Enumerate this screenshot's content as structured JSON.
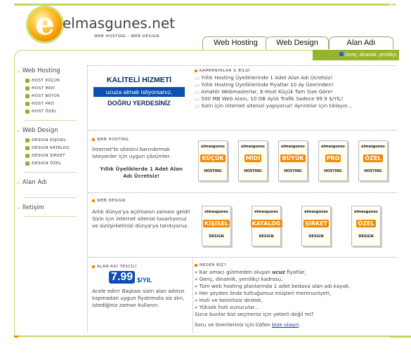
{
  "site": {
    "logo_glyph": "e",
    "name": "elmasgunes.net",
    "tagline": "WEB HOSTING - WEB DESIGN",
    "slogan": "Genç, dinamik, yenilikçi",
    "tabs": [
      {
        "label": "Web Hosting"
      },
      {
        "label": "Web Design"
      },
      {
        "label": "Alan Adı"
      }
    ],
    "accent_color": "#96b52e",
    "highlight_color": "#f08a00"
  },
  "sidebar": {
    "web_hosting": "Web Hosting",
    "hosting_items": [
      "-HOST KÜÇÜK",
      "-HOST MİDİ",
      "-HOST BÜYÜK",
      "-HOST PRO",
      "-HOST ÖZEL"
    ],
    "web_design": "Web Design",
    "design_items": [
      "-DESIGN KİŞİSEL",
      "-DESIGN KATALOG",
      "-DESIGN ŞİRKET",
      "-DESIGN ÖZEL"
    ],
    "alan_adi": "Alan Adı",
    "iletisim": "İletişim"
  },
  "promo": {
    "line1": "KALİTELİ HİZMETİ",
    "line2": "ucuza almak istiyorsanız,",
    "line3": "DOĞRU YERDESİNİZ"
  },
  "campaigns": {
    "heading": "KAMPANYALAR & BİLGİ",
    "items": [
      ":.: Yıllık Hosting Üyeliklerinde 1 Adet Alan Adı Ücretsiz!",
      ":.: Yıllık Hosting Üyeliklerinde Fiyatlar 10 Ay Üzerinden!",
      ":.: Amatör Webmasterlar, E-Host Küçük Tam Size Göre!",
      ":.: 500 MB Web Alanı, 10 GB Aylık Trafik Sadece 99.9 $/YIL!",
      ":.: Sizin için internet sitenizi yapıyoruz! Ayrıntılar için tıklayın..."
    ]
  },
  "hosting": {
    "heading": "WEB HOSTING",
    "text": "İnternet'te sitesini barındırmak isteyenler için uygun çözümler.",
    "note": "Yıllık Üyeliklerde 1 Adet Alan Adı Ücretsiz!",
    "brand": "elmasgunes",
    "packages": [
      "KÜÇÜK",
      "MİDİ",
      "BÜYÜK",
      "PRO",
      "ÖZEL"
    ],
    "package_footer": "HOSTING"
  },
  "design": {
    "heading": "WEB DESIGN",
    "text": "Artık dünya'ya açılmanın zamanı geldi! Sizin için internet sitenizi tasarlıyoruz ve sizi/şirketinizi dünya'ya tanıtıyoruz.",
    "brand": "elmasgunes",
    "packages": [
      "KİŞİSEL",
      "KATALOG",
      "ŞİRKET",
      "ÖZEL"
    ],
    "package_footer": "DESIGN"
  },
  "domain": {
    "heading": "ALAN-ADI TESCİLİ",
    "price": "7.99",
    "unit": "$/YIL",
    "text": "Acele edin! Başkası sizin alan adınızı kapmadan uygun fiyatımızla siz alın, istediğiniz zaman kullanın."
  },
  "why": {
    "heading": "NEDEN BİZ?",
    "item1_pre": "» Kar amacı gütmeden oluşan ",
    "item1_bold": "ucuz",
    "item1_post": " fiyatlar,",
    "items": [
      "» Genç, dinamik, yenilikçi kadrosu,",
      "» Tüm web hosting planlarında 1 adet bedava alan adı kayıdı,",
      "» Her şeyden önde tuttuğumuz müşteri memnuniyeti,",
      "» Hızlı ve kesintisiz destek,",
      "» Yüksek hızlı sunucular..."
    ],
    "question": "Sizce bunlar bizi seçmeniz için yeterli değil mi?",
    "contact_text": "Soru ve önerileriniz için lütfen",
    "contact_link": "bize ulaşın",
    "contact_end": "."
  }
}
